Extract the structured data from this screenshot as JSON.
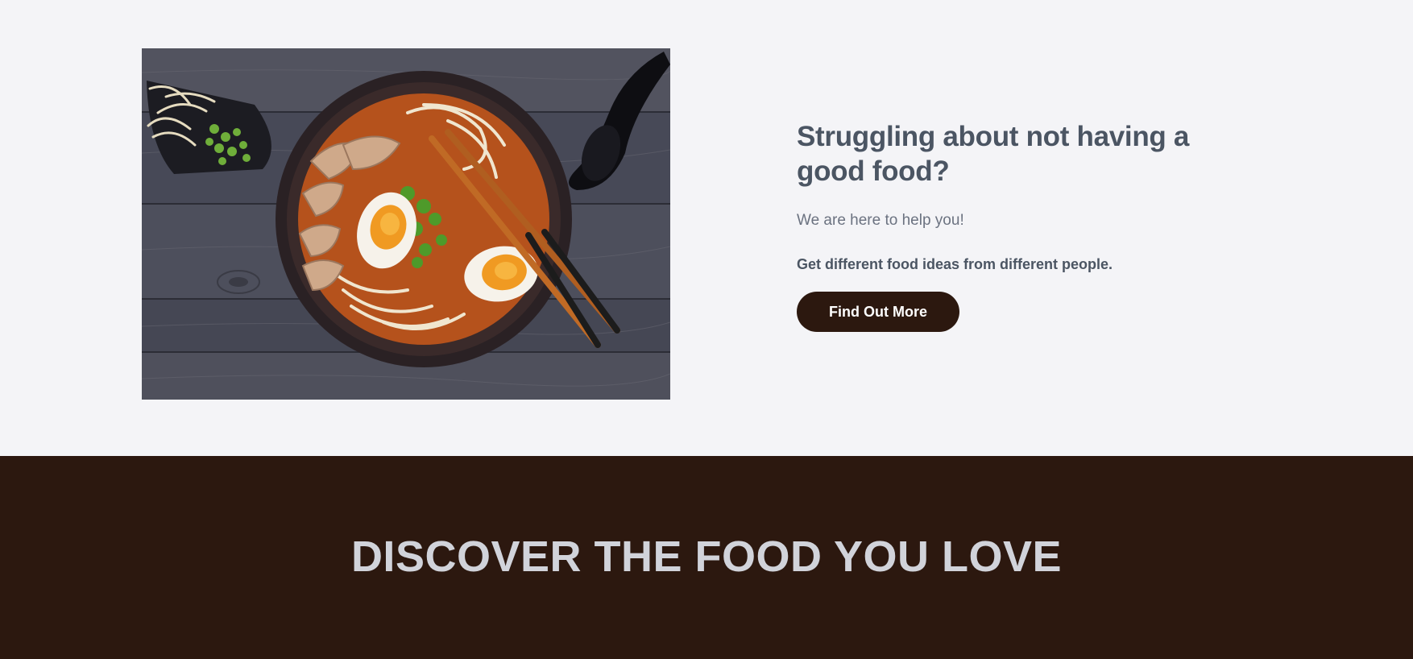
{
  "hero": {
    "image_alt": "Bowl of ramen with eggs, chicken, noodles and scallions on a wooden table",
    "title": "Struggling about not having a good food?",
    "subtitle": "We are here to help you!",
    "tagline": "Get different food ideas from different people.",
    "cta_label": "Find Out More"
  },
  "discover": {
    "title": "DISCOVER THE FOOD YOU LOVE"
  },
  "colors": {
    "page_background": "#f4f4f7",
    "heading": "#4b5563",
    "body_text": "#6b7280",
    "brand_dark": "#2c180f",
    "banner_text": "#d1d3da"
  }
}
